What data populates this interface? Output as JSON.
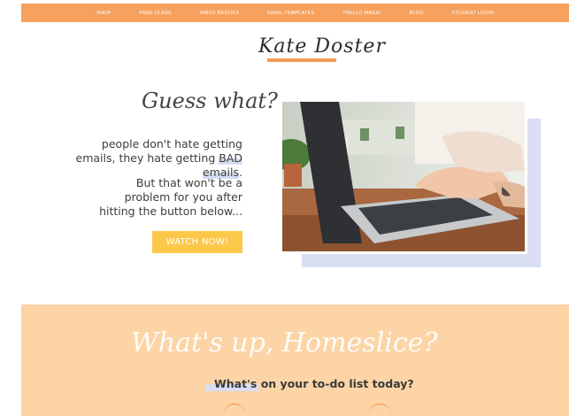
{
  "nav": {
    "items": [
      "SHOP",
      "FREE CLASS",
      "INBOX BESTIES",
      "EMAIL TEMPLATES",
      "TRELLO MAGIC",
      "BLOG",
      "STUDENT LOGIN"
    ]
  },
  "brand": {
    "logo_text": "Kate Doster"
  },
  "hero": {
    "heading": "Guess what?",
    "line1_prefix": "people don't hate getting emails, they hate getting ",
    "line1_highlight": "BAD emails",
    "line1_suffix": ".",
    "line2": "But that won't be a problem for you after hitting the button below...",
    "button_label": "WATCH NOW!"
  },
  "section2": {
    "script_heading": "What's up, Homeslice?",
    "subheading": "What's on your to-do list today?"
  },
  "colors": {
    "nav_bg": "#f6a15e",
    "button_bg": "#fbc84a",
    "accent_lavender": "#d9def3",
    "section2_bg": "#fcd4a6"
  }
}
